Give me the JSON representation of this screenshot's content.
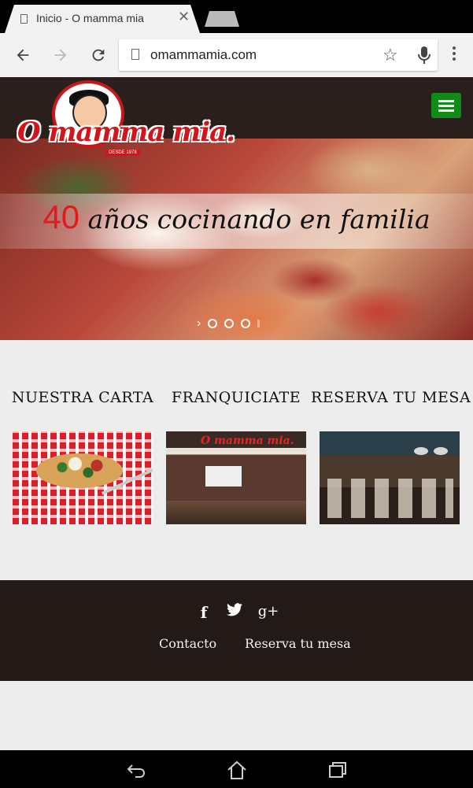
{
  "browser": {
    "tab_title": "Inicio - O mamma mia",
    "tab_close": "✕",
    "url": "omammamia.com"
  },
  "site": {
    "logo_text": "O mamma mia.",
    "logo_sub": "DESDE 1978"
  },
  "hero": {
    "number": "40",
    "caption": "años cocinando en familia",
    "slide_count": 3,
    "active_slide": 1
  },
  "cards": [
    {
      "title": "NUESTRA CARTA"
    },
    {
      "title": "FRANQUICIATE",
      "image_sign": "O mamma mia."
    },
    {
      "title": "RESERVA TU MESA"
    }
  ],
  "footer": {
    "social": [
      "facebook-icon",
      "twitter-icon",
      "google-plus-icon"
    ],
    "social_glyphs": {
      "facebook": "f",
      "google": "g+"
    },
    "links": [
      "Contacto",
      "Reserva tu mesa"
    ]
  },
  "colors": {
    "header_bg": "#2b1f1d",
    "footer_bg": "#231a17",
    "menu_green": "#128a17",
    "accent_red": "#e01b1b"
  }
}
